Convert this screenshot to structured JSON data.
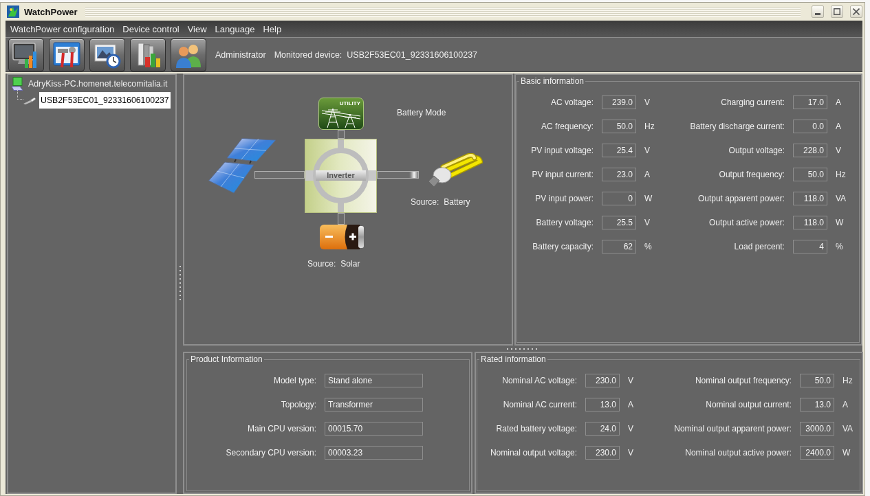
{
  "window": {
    "title": "WatchPower"
  },
  "menu": [
    "WatchPower configuration",
    "Device control",
    "View",
    "Language",
    "Help"
  ],
  "toolbar": {
    "user": "Administrator",
    "device_caption": "Monitored device:",
    "device": "USB2F53EC01_92331606100237"
  },
  "tree": [
    {
      "kind": "computer",
      "label": "AdryKiss-PC.homenet.telecomitalia.it",
      "selected": false,
      "children": [
        {
          "kind": "usb",
          "label": "USB2F53EC01_92331606100237",
          "selected": true
        }
      ]
    }
  ],
  "diagram": {
    "mode": "Battery Mode",
    "utility_label": "UTILITY",
    "inverter_label": "Inverter",
    "load_source": {
      "label": "Source:",
      "value": "Battery"
    },
    "battery_source": {
      "label": "Source:",
      "value": "Solar"
    }
  },
  "basic_information": {
    "title": "Basic information",
    "fields": [
      {
        "label": "AC voltage:",
        "value": "239.0",
        "unit": "V"
      },
      {
        "label": "Charging current:",
        "value": "17.0",
        "unit": "A"
      },
      {
        "label": "AC frequency:",
        "value": "50.0",
        "unit": "Hz"
      },
      {
        "label": "Battery discharge current:",
        "value": "0.0",
        "unit": "A"
      },
      {
        "label": "PV input voltage:",
        "value": "25.4",
        "unit": "V"
      },
      {
        "label": "Output voltage:",
        "value": "228.0",
        "unit": "V"
      },
      {
        "label": "PV input current:",
        "value": "23.0",
        "unit": "A"
      },
      {
        "label": "Output frequency:",
        "value": "50.0",
        "unit": "Hz"
      },
      {
        "label": "PV input power:",
        "value": "0",
        "unit": "W"
      },
      {
        "label": "Output apparent power:",
        "value": "118.0",
        "unit": "VA"
      },
      {
        "label": "Battery voltage:",
        "value": "25.5",
        "unit": "V"
      },
      {
        "label": "Output active power:",
        "value": "118.0",
        "unit": "W"
      },
      {
        "label": "Battery capacity:",
        "value": "62",
        "unit": "%"
      },
      {
        "label": "Load percent:",
        "value": "4",
        "unit": "%"
      }
    ]
  },
  "product_information": {
    "title": "Product Information",
    "fields": [
      {
        "label": "Model type:",
        "value": "Stand alone"
      },
      {
        "label": "Topology:",
        "value": "Transformer"
      },
      {
        "label": "Main CPU version:",
        "value": "00015.70"
      },
      {
        "label": "Secondary CPU version:",
        "value": "00003.23"
      }
    ]
  },
  "rated_information": {
    "title": "Rated information",
    "fields": [
      {
        "label": "Nominal AC voltage:",
        "value": "230.0",
        "unit": "V"
      },
      {
        "label": "Nominal output frequency:",
        "value": "50.0",
        "unit": "Hz"
      },
      {
        "label": "Nominal AC current:",
        "value": "13.0",
        "unit": "A"
      },
      {
        "label": "Nominal output current:",
        "value": "13.0",
        "unit": "A"
      },
      {
        "label": "Rated battery voltage:",
        "value": "24.0",
        "unit": "V"
      },
      {
        "label": "Nominal output apparent power:",
        "value": "3000.0",
        "unit": "VA"
      },
      {
        "label": "Nominal output voltage:",
        "value": "230.0",
        "unit": "V"
      },
      {
        "label": "Nominal output active power:",
        "value": "2400.0",
        "unit": "W"
      }
    ]
  }
}
